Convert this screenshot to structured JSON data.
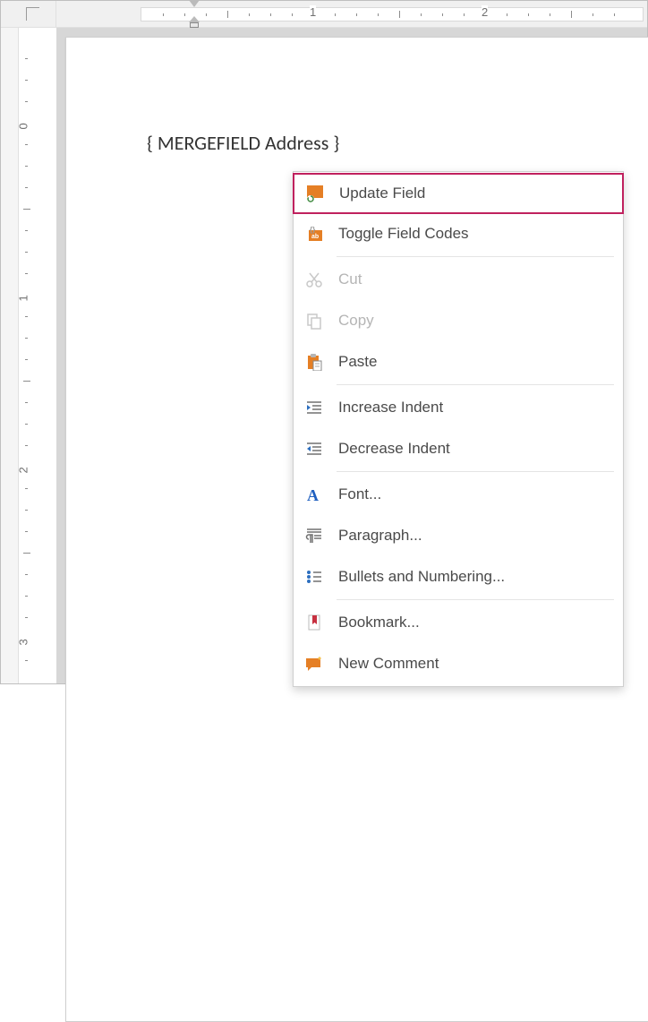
{
  "document": {
    "fieldcode": "{ MERGEFIELD Address }"
  },
  "ruler": {
    "h_numbers": [
      "1",
      "2"
    ],
    "v_numbers": [
      "0",
      "1",
      "2",
      "3"
    ]
  },
  "context_menu": {
    "items": [
      {
        "label": "Update Field",
        "icon": "refresh-field-icon",
        "highlight": true,
        "disabled": false
      },
      {
        "label": "Toggle Field Codes",
        "icon": "toggle-field-icon",
        "highlight": false,
        "disabled": false
      },
      {
        "sep": true
      },
      {
        "label": "Cut",
        "icon": "cut-icon",
        "highlight": false,
        "disabled": true
      },
      {
        "label": "Copy",
        "icon": "copy-icon",
        "highlight": false,
        "disabled": true
      },
      {
        "label": "Paste",
        "icon": "paste-icon",
        "highlight": false,
        "disabled": false
      },
      {
        "sep": true
      },
      {
        "label": "Increase Indent",
        "icon": "increase-indent-icon",
        "highlight": false,
        "disabled": false
      },
      {
        "label": "Decrease Indent",
        "icon": "decrease-indent-icon",
        "highlight": false,
        "disabled": false
      },
      {
        "sep": true
      },
      {
        "label": "Font...",
        "icon": "font-icon",
        "highlight": false,
        "disabled": false
      },
      {
        "label": "Paragraph...",
        "icon": "paragraph-icon",
        "highlight": false,
        "disabled": false
      },
      {
        "label": "Bullets and Numbering...",
        "icon": "bullets-icon",
        "highlight": false,
        "disabled": false
      },
      {
        "sep": true
      },
      {
        "label": "Bookmark...",
        "icon": "bookmark-icon",
        "highlight": false,
        "disabled": false
      },
      {
        "label": "New Comment",
        "icon": "comment-icon",
        "highlight": false,
        "disabled": false
      }
    ]
  },
  "colors": {
    "accent": "#e57f25",
    "highlight_border": "#c0215e",
    "font_icon_blue": "#2060c0"
  }
}
